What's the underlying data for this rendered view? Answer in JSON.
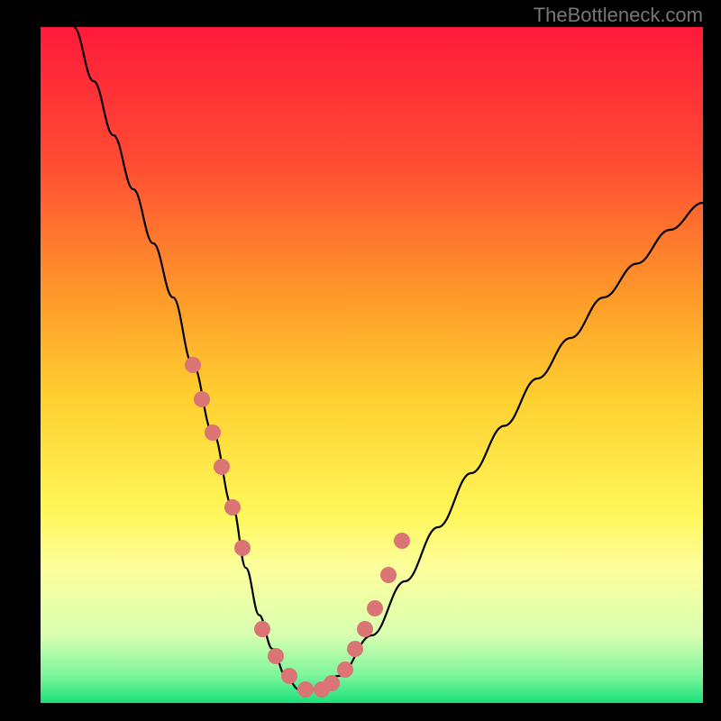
{
  "watermark": "TheBottleneck.com",
  "colors": {
    "bg_black": "#000000",
    "dot": "#db7474",
    "curve": "#000000"
  },
  "chart_data": {
    "type": "line",
    "title": "",
    "xlabel": "",
    "ylabel": "",
    "xlim": [
      0,
      100
    ],
    "ylim": [
      0,
      100
    ],
    "background_gradient": {
      "stops": [
        {
          "pos": 0.0,
          "color": "#ff1a3a"
        },
        {
          "pos": 0.2,
          "color": "#ff4c33"
        },
        {
          "pos": 0.4,
          "color": "#ff9a2a"
        },
        {
          "pos": 0.55,
          "color": "#ffd030"
        },
        {
          "pos": 0.72,
          "color": "#fff75a"
        },
        {
          "pos": 0.8,
          "color": "#fdff9c"
        },
        {
          "pos": 0.9,
          "color": "#d8ffb0"
        },
        {
          "pos": 0.96,
          "color": "#7cf59c"
        },
        {
          "pos": 1.0,
          "color": "#19e07a"
        }
      ]
    },
    "series": [
      {
        "name": "bottleneck-curve",
        "x": [
          5,
          8,
          11,
          14,
          17,
          20,
          23,
          26,
          29,
          31,
          33,
          35,
          37,
          39,
          41,
          45,
          50,
          55,
          60,
          65,
          70,
          75,
          80,
          85,
          90,
          95,
          100
        ],
        "y": [
          100,
          92,
          84,
          76,
          68,
          60,
          50,
          40,
          29,
          20,
          13,
          8,
          4,
          2,
          2,
          4,
          10,
          18,
          26,
          34,
          41,
          48,
          54,
          60,
          65,
          70,
          74
        ]
      }
    ],
    "highlight_points": {
      "name": "marked-dots",
      "x": [
        23.0,
        24.4,
        26.0,
        27.3,
        29.0,
        30.5,
        33.5,
        35.5,
        37.5,
        40.0,
        42.5,
        44.0,
        46.0,
        47.5,
        49.0,
        50.5,
        52.5,
        54.5
      ],
      "y": [
        50,
        45,
        40,
        35,
        29,
        23,
        11,
        7,
        4,
        2,
        2,
        3,
        5,
        8,
        11,
        14,
        19,
        24
      ]
    }
  }
}
